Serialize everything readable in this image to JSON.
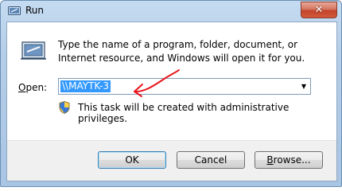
{
  "window": {
    "title": "Run",
    "close_glyph": "✕"
  },
  "content": {
    "description": "Type the name of a program, folder, document, or Internet resource, and Windows will open it for you.",
    "open_label_accel": "O",
    "open_label_rest": "pen:",
    "open_value": "\\\\MAYTK-3",
    "admin_note": "This task will be created with administrative privileges."
  },
  "buttons": {
    "ok": "OK",
    "cancel": "Cancel",
    "browse_accel": "B",
    "browse_rest": "rowse..."
  },
  "colors": {
    "selection": "#3399ff",
    "annotation": "#e8141b"
  }
}
